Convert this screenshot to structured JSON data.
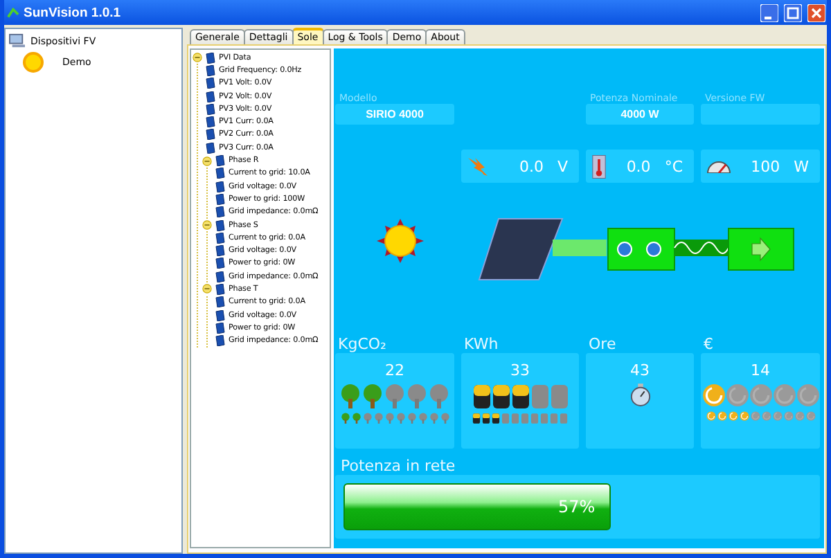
{
  "window": {
    "title": "SunVision 1.0.1"
  },
  "devices": [
    {
      "label": "Dispositivi FV",
      "children": [
        {
          "label": "Demo",
          "selected": false
        }
      ]
    }
  ],
  "tabs": [
    {
      "label": "Generale",
      "selected": false
    },
    {
      "label": "Dettagli",
      "selected": false
    },
    {
      "label": "Sole",
      "selected": true
    },
    {
      "label": "Log & Tools",
      "selected": false
    },
    {
      "label": "Demo",
      "selected": false
    },
    {
      "label": "About",
      "selected": false
    }
  ],
  "data_tree": [
    {
      "label": "PVI Data",
      "expanded": true,
      "children": [
        {
          "label": "Grid Frequency: 0.0Hz"
        },
        {
          "label": "PV1 Volt: 0.0V"
        },
        {
          "label": "PV2 Volt: 0.0V"
        },
        {
          "label": "PV3 Volt: 0.0V"
        },
        {
          "label": "PV1 Curr: 0.0A"
        },
        {
          "label": "PV2 Curr: 0.0A"
        },
        {
          "label": "PV3 Curr: 0.0A"
        },
        {
          "label": "Phase R",
          "expanded": true,
          "children": [
            {
              "label": "Current to grid: 10.0A"
            },
            {
              "label": "Grid voltage: 0.0V"
            },
            {
              "label": "Power to grid: 100W"
            },
            {
              "label": "Grid impedance: 0.0mΩ"
            }
          ]
        },
        {
          "label": "Phase S",
          "expanded": true,
          "children": [
            {
              "label": "Current to grid: 0.0A"
            },
            {
              "label": "Grid voltage: 0.0V"
            },
            {
              "label": "Power to grid: 0W"
            },
            {
              "label": "Grid impedance: 0.0mΩ"
            }
          ]
        },
        {
          "label": "Phase T",
          "expanded": true,
          "children": [
            {
              "label": "Current to grid: 0.0A"
            },
            {
              "label": "Grid voltage: 0.0V"
            },
            {
              "label": "Power to grid: 0W"
            },
            {
              "label": "Grid impedance: 0.0mΩ"
            }
          ]
        }
      ]
    }
  ],
  "info": {
    "model": {
      "label": "Modello",
      "value": "SIRIO 4000"
    },
    "nominal_power": {
      "label": "Potenza Nominale",
      "value": "4000 W"
    },
    "firmware": {
      "label": "Versione FW"
    }
  },
  "readings": [
    {
      "kind": "voltage",
      "value": "0.0",
      "unit": "V"
    },
    {
      "kind": "temperature",
      "value": "0.0",
      "unit": "°C"
    },
    {
      "kind": "power",
      "value": "100",
      "unit": "W"
    }
  ],
  "stats": [
    {
      "kind": "tree",
      "title": "KgCO₂",
      "value": "22",
      "big_row": {
        "stars": 2
      },
      "small_row": {
        "stars": 2
      }
    },
    {
      "kind": "battery",
      "title": "KWh",
      "value": "33",
      "big_row": {
        "stars": 3
      },
      "small_row": {
        "stars": 3
      }
    },
    {
      "kind": "timer",
      "title": "Ore",
      "value": "43"
    },
    {
      "kind": "coin",
      "title": "€",
      "value": "14",
      "big_row": {
        "stars": 1
      },
      "small_row": {
        "stars": 4
      }
    }
  ],
  "grid_power": {
    "label": "Potenza in rete",
    "level": 0.57,
    "reading": "57%"
  }
}
